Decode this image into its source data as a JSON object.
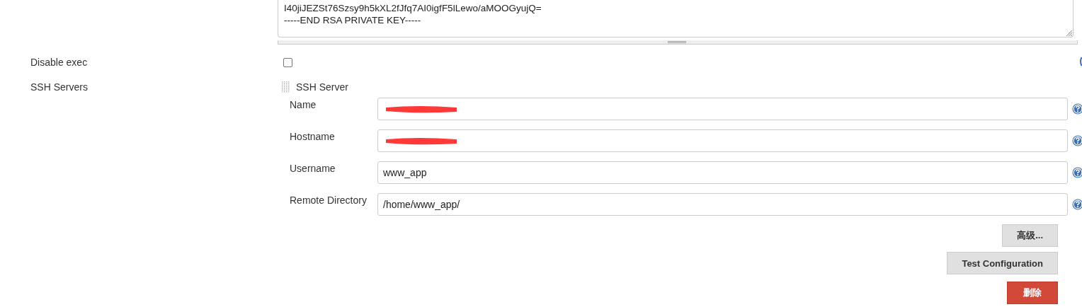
{
  "private_key": {
    "lines": [
      "I40jiJEZSt76Szsy9h5kXL2fJfq7AI0igfF5lLewo/aMOOGyujQ=",
      "-----END RSA PRIVATE KEY-----"
    ]
  },
  "disable_exec": {
    "label": "Disable exec",
    "checked": false
  },
  "ssh_servers": {
    "label": "SSH Servers",
    "server": {
      "title": "SSH Server",
      "fields": [
        {
          "label": "Name",
          "redacted": true
        },
        {
          "label": "Hostname",
          "redacted": true
        },
        {
          "label": "Username",
          "value": "www_app",
          "redacted": false
        },
        {
          "label": "Remote Directory",
          "value": "/home/www_app/",
          "redacted": false
        }
      ],
      "buttons": [
        {
          "label": "高级...",
          "kind": "default"
        },
        {
          "label": "Test Configuration",
          "kind": "default"
        },
        {
          "label": "删除",
          "kind": "danger"
        }
      ]
    }
  }
}
